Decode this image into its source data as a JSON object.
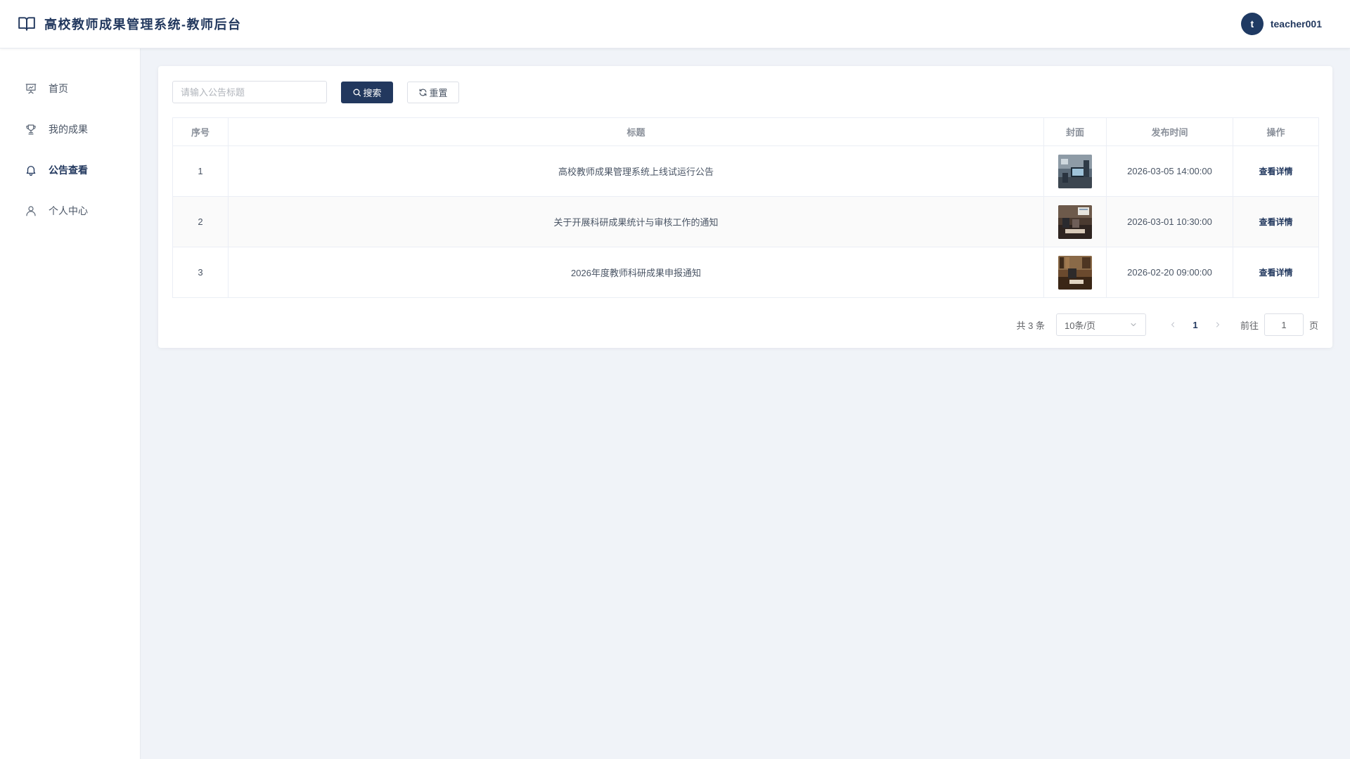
{
  "header": {
    "title": "高校教师成果管理系统-教师后台",
    "user": {
      "avatar_letter": "t",
      "username": "teacher001"
    }
  },
  "sidebar": {
    "items": [
      {
        "label": "首页",
        "icon": "presentation-chart-icon",
        "active": false
      },
      {
        "label": "我的成果",
        "icon": "trophy-icon",
        "active": false
      },
      {
        "label": "公告查看",
        "icon": "bell-icon",
        "active": true
      },
      {
        "label": "个人中心",
        "icon": "user-icon",
        "active": false
      }
    ]
  },
  "toolbar": {
    "search_placeholder": "请输入公告标题",
    "search_value": "",
    "search_label": "搜索",
    "reset_label": "重置"
  },
  "table": {
    "columns": [
      "序号",
      "标题",
      "封面",
      "发布时间",
      "操作"
    ],
    "rows": [
      {
        "index": "1",
        "title": "高校教师成果管理系统上线试运行公告",
        "time": "2026-03-05 14:00:00",
        "action": "查看详情"
      },
      {
        "index": "2",
        "title": "关于开展科研成果统计与审核工作的通知",
        "time": "2026-03-01 10:30:00",
        "action": "查看详情"
      },
      {
        "index": "3",
        "title": "2026年度教师科研成果申报通知",
        "time": "2026-02-20 09:00:00",
        "action": "查看详情"
      }
    ]
  },
  "pagination": {
    "total_text": "共 3 条",
    "page_size": "10条/页",
    "current_page": "1",
    "goto_prefix": "前往",
    "goto_value": "1",
    "goto_suffix": "页"
  },
  "colors": {
    "primary": "#22385e",
    "background": "#f0f3f8"
  }
}
